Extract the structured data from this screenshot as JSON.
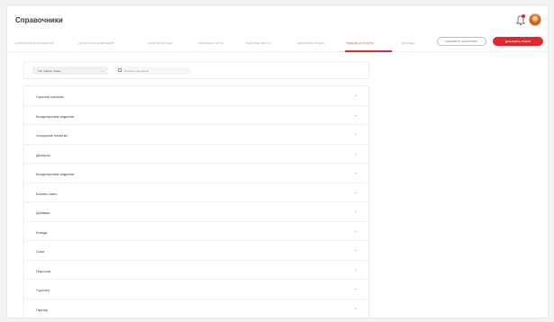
{
  "header": {
    "title": "Справочники"
  },
  "tabs": [
    {
      "label": "Категории документов"
    },
    {
      "label": "Категории компаний"
    },
    {
      "label": "Категории цен"
    },
    {
      "label": "Приемы статус"
    },
    {
      "label": "Рабочие места"
    },
    {
      "label": "Единицы отчета"
    },
    {
      "label": "Товары и услуги",
      "active": true
    },
    {
      "label": "Склады"
    }
  ],
  "actions": {
    "add_category": "Добавить категорию",
    "add_item": "Добавить товар"
  },
  "filter": {
    "select_value": "Тип товара: Товар",
    "checkbox_label": "Показать архивные"
  },
  "categories": [
    "Горячие напитки",
    "Кондитерские изделия",
    "Холодные напитки",
    "Десерты",
    "Кондитерские изделия",
    "Бизнес-ланч",
    "Добавки",
    "Блюда",
    "Соки",
    "Персона",
    "Горячее",
    "Гарнир"
  ],
  "icons": {
    "bell": "bell-icon",
    "avatar": "avatar",
    "chevron": "chevron-down-icon"
  },
  "colors": {
    "accent": "#e02b2f",
    "primary_button": "#e8232a"
  }
}
